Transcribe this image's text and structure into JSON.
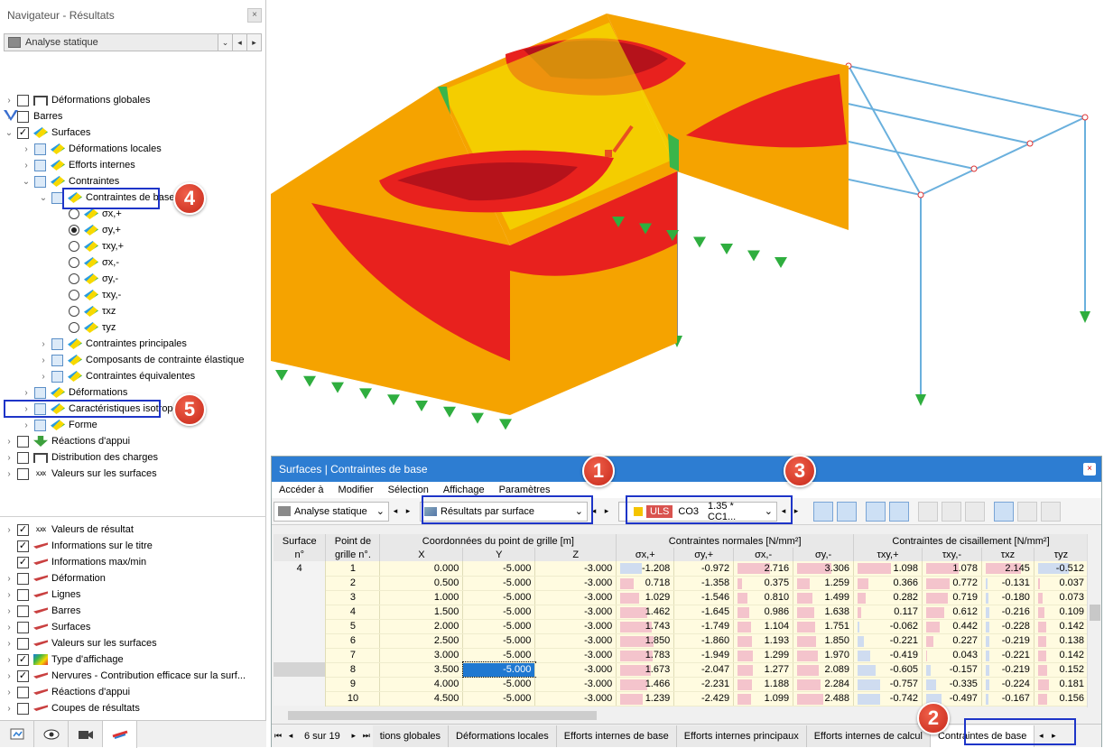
{
  "navigator": {
    "title": "Navigateur - Résultats",
    "combo": "Analyse statique",
    "tree": [
      {
        "label": "Déformations globales",
        "indent": 0,
        "exp": "›",
        "ctl": "cb",
        "icon": "frame"
      },
      {
        "label": "Barres",
        "indent": 0,
        "exp": "›",
        "ctl": "cb",
        "icon": "bar"
      },
      {
        "label": "Surfaces",
        "indent": 0,
        "exp": "⌄",
        "ctl": "cbchk",
        "icon": "surf"
      },
      {
        "label": "Déformations locales",
        "indent": 1,
        "exp": "›",
        "ctl": "cbblue",
        "icon": "surf"
      },
      {
        "label": "Efforts internes",
        "indent": 1,
        "exp": "›",
        "ctl": "cbblue",
        "icon": "surf"
      },
      {
        "label": "Contraintes",
        "indent": 1,
        "exp": "⌄",
        "ctl": "cbblue",
        "icon": "surf"
      },
      {
        "label": "Contraintes de base",
        "indent": 2,
        "exp": "⌄",
        "ctl": "cbblue",
        "icon": "surf"
      },
      {
        "label": "σx,+",
        "indent": 3,
        "exp": "",
        "ctl": "rd",
        "icon": "surf"
      },
      {
        "label": "σy,+",
        "indent": 3,
        "exp": "",
        "ctl": "rdon",
        "icon": "surf"
      },
      {
        "label": "τxy,+",
        "indent": 3,
        "exp": "",
        "ctl": "rd",
        "icon": "surf"
      },
      {
        "label": "σx,-",
        "indent": 3,
        "exp": "",
        "ctl": "rd",
        "icon": "surf"
      },
      {
        "label": "σy,-",
        "indent": 3,
        "exp": "",
        "ctl": "rd",
        "icon": "surf"
      },
      {
        "label": "τxy,-",
        "indent": 3,
        "exp": "",
        "ctl": "rd",
        "icon": "surf"
      },
      {
        "label": "τxz",
        "indent": 3,
        "exp": "",
        "ctl": "rd",
        "icon": "surf"
      },
      {
        "label": "τyz",
        "indent": 3,
        "exp": "",
        "ctl": "rd",
        "icon": "surf"
      },
      {
        "label": "Contraintes principales",
        "indent": 2,
        "exp": "›",
        "ctl": "cbblue",
        "icon": "surf"
      },
      {
        "label": "Composants de contrainte élastique",
        "indent": 2,
        "exp": "›",
        "ctl": "cbblue",
        "icon": "surf"
      },
      {
        "label": "Contraintes équivalentes",
        "indent": 2,
        "exp": "›",
        "ctl": "cbblue",
        "icon": "surf"
      },
      {
        "label": "Déformations",
        "indent": 1,
        "exp": "›",
        "ctl": "cbblue",
        "icon": "surf"
      },
      {
        "label": "Caractéristiques isotropes",
        "indent": 1,
        "exp": "›",
        "ctl": "cbblue",
        "icon": "surf"
      },
      {
        "label": "Forme",
        "indent": 1,
        "exp": "›",
        "ctl": "cbblue",
        "icon": "surf"
      },
      {
        "label": "Réactions d'appui",
        "indent": 0,
        "exp": "›",
        "ctl": "cb",
        "icon": "res"
      },
      {
        "label": "Distribution des charges",
        "indent": 0,
        "exp": "›",
        "ctl": "cb",
        "icon": "frame"
      },
      {
        "label": "Valeurs sur les surfaces",
        "indent": 0,
        "exp": "›",
        "ctl": "cb",
        "icon": "val"
      }
    ],
    "options": [
      {
        "label": "Valeurs de résultat",
        "exp": "›",
        "ctl": "cbchk",
        "icon": "val"
      },
      {
        "label": "Informations sur le titre",
        "exp": "",
        "ctl": "cbchk",
        "icon": "tool"
      },
      {
        "label": "Informations max/min",
        "exp": "",
        "ctl": "cbchk",
        "icon": "tool"
      },
      {
        "label": "Déformation",
        "exp": "›",
        "ctl": "cb",
        "icon": "tool"
      },
      {
        "label": "Lignes",
        "exp": "›",
        "ctl": "cb",
        "icon": "tool"
      },
      {
        "label": "Barres",
        "exp": "›",
        "ctl": "cb",
        "icon": "tool"
      },
      {
        "label": "Surfaces",
        "exp": "›",
        "ctl": "cb",
        "icon": "tool"
      },
      {
        "label": "Valeurs sur les surfaces",
        "exp": "›",
        "ctl": "cb",
        "icon": "tool"
      },
      {
        "label": "Type d'affichage",
        "exp": "›",
        "ctl": "cbchk",
        "icon": "rainbow"
      },
      {
        "label": "Nervures - Contribution efficace sur la surf...",
        "exp": "›",
        "ctl": "cbchk",
        "icon": "tool"
      },
      {
        "label": "Réactions d'appui",
        "exp": "›",
        "ctl": "cb",
        "icon": "tool"
      },
      {
        "label": "Coupes de résultats",
        "exp": "›",
        "ctl": "cb",
        "icon": "tool"
      }
    ]
  },
  "panel": {
    "title": "Surfaces | Contraintes de base",
    "menu": [
      "Accéder à",
      "Modifier",
      "Sélection",
      "Affichage",
      "Paramètres"
    ],
    "analysis": "Analyse statique",
    "results": "Résultats par surface",
    "uls": "ULS",
    "co": "CO3",
    "combo_formula": "1.35 * CC1...",
    "headers": {
      "surface": "Surface",
      "surface2": "n°",
      "point": "Point de",
      "point2": "grille n°.",
      "coords": "Coordonnées du point de grille [m]",
      "x": "X",
      "y": "Y",
      "z": "Z",
      "normal": "Contraintes normales [N/mm²]",
      "sxp": "σx,+",
      "syp": "σy,+",
      "sxm": "σx,-",
      "sym": "σy,-",
      "shear": "Contraintes de cisaillement [N/mm²]",
      "txyp": "τxy,+",
      "txym": "τxy,-",
      "txz": "τxz",
      "tyz": "τyz"
    },
    "rows": [
      {
        "s": "4",
        "p": "1",
        "x": "0.000",
        "y": "-5.000",
        "z": "-3.000",
        "sxp": "-1.208",
        "syp": "-0.972",
        "sxm": "2.716",
        "sym": "3.306",
        "txyp": "1.098",
        "txym": "1.078",
        "txz": "2.145",
        "tyz": "-0.512"
      },
      {
        "s": "",
        "p": "2",
        "x": "0.500",
        "y": "-5.000",
        "z": "-3.000",
        "sxp": "0.718",
        "syp": "-1.358",
        "sxm": "0.375",
        "sym": "1.259",
        "txyp": "0.366",
        "txym": "0.772",
        "txz": "-0.131",
        "tyz": "0.037"
      },
      {
        "s": "",
        "p": "3",
        "x": "1.000",
        "y": "-5.000",
        "z": "-3.000",
        "sxp": "1.029",
        "syp": "-1.546",
        "sxm": "0.810",
        "sym": "1.499",
        "txyp": "0.282",
        "txym": "0.719",
        "txz": "-0.180",
        "tyz": "0.073"
      },
      {
        "s": "",
        "p": "4",
        "x": "1.500",
        "y": "-5.000",
        "z": "-3.000",
        "sxp": "1.462",
        "syp": "-1.645",
        "sxm": "0.986",
        "sym": "1.638",
        "txyp": "0.117",
        "txym": "0.612",
        "txz": "-0.216",
        "tyz": "0.109"
      },
      {
        "s": "",
        "p": "5",
        "x": "2.000",
        "y": "-5.000",
        "z": "-3.000",
        "sxp": "1.743",
        "syp": "-1.749",
        "sxm": "1.104",
        "sym": "1.751",
        "txyp": "-0.062",
        "txym": "0.442",
        "txz": "-0.228",
        "tyz": "0.142"
      },
      {
        "s": "",
        "p": "6",
        "x": "2.500",
        "y": "-5.000",
        "z": "-3.000",
        "sxp": "1.850",
        "syp": "-1.860",
        "sxm": "1.193",
        "sym": "1.850",
        "txyp": "-0.221",
        "txym": "0.227",
        "txz": "-0.219",
        "tyz": "0.138"
      },
      {
        "s": "",
        "p": "7",
        "x": "3.000",
        "y": "-5.000",
        "z": "-3.000",
        "sxp": "1.783",
        "syp": "-1.949",
        "sxm": "1.299",
        "sym": "1.970",
        "txyp": "-0.419",
        "txym": "0.043",
        "txz": "-0.221",
        "tyz": "0.142"
      },
      {
        "s": "",
        "p": "8",
        "x": "3.500",
        "y": "-5.000",
        "z": "-3.000",
        "sxp": "1.673",
        "syp": "-2.047",
        "sxm": "1.277",
        "sym": "2.089",
        "txyp": "-0.605",
        "txym": "-0.157",
        "txz": "-0.219",
        "tyz": "0.152"
      },
      {
        "s": "",
        "p": "9",
        "x": "4.000",
        "y": "-5.000",
        "z": "-3.000",
        "sxp": "1.466",
        "syp": "-2.231",
        "sxm": "1.188",
        "sym": "2.284",
        "txyp": "-0.757",
        "txym": "-0.335",
        "txz": "-0.224",
        "tyz": "0.181"
      },
      {
        "s": "",
        "p": "10",
        "x": "4.500",
        "y": "-5.000",
        "z": "-3.000",
        "sxp": "1.239",
        "syp": "-2.429",
        "sxm": "1.099",
        "sym": "2.488",
        "txyp": "-0.742",
        "txym": "-0.497",
        "txz": "-0.167",
        "tyz": "0.156"
      }
    ],
    "pager": "6 sur 19",
    "tabs": [
      "tions globales",
      "Déformations locales",
      "Efforts internes de base",
      "Efforts internes principaux",
      "Efforts internes de calcul",
      "Contraintes de base"
    ]
  },
  "badges": [
    "1",
    "2",
    "3",
    "4",
    "5"
  ],
  "colors": {
    "accent": "#2d7dd2",
    "highlight": "#1e35c8",
    "badge": "#d63a26",
    "orange": "#f5a300",
    "red": "#e8211e",
    "darkred": "#b5121b",
    "yellow": "#f2f000",
    "frame": "#6ab0dd",
    "support": "#2fae3f"
  }
}
